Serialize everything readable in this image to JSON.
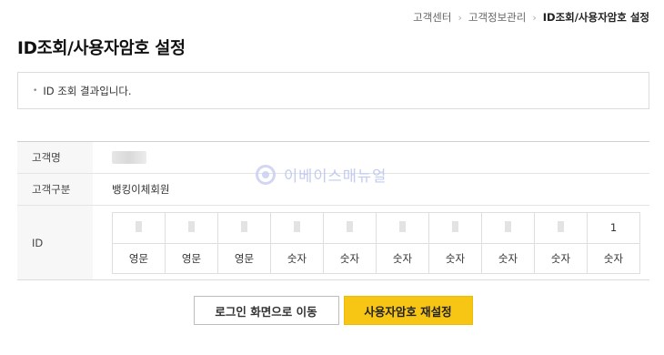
{
  "breadcrumb": {
    "items": [
      "고객센터",
      "고객정보관리",
      "ID조회/사용자암호 설정"
    ]
  },
  "page_title": "ID조회/사용자암호 설정",
  "result_message": "ID 조회 결과입니다.",
  "table": {
    "name_label": "고객명",
    "type_label": "고객구분",
    "type_value": "뱅킹이체회원",
    "id_label": "ID"
  },
  "id_chars": [
    "",
    "",
    "",
    "",
    "",
    "",
    "",
    "",
    "",
    "1"
  ],
  "id_kinds": [
    "영문",
    "영문",
    "영문",
    "숫자",
    "숫자",
    "숫자",
    "숫자",
    "숫자",
    "숫자",
    "숫자"
  ],
  "watermark": "이베이스매뉴얼",
  "buttons": {
    "login": "로그인 화면으로 이동",
    "reset": "사용자암호 재설정"
  },
  "colors": {
    "accent_button": "#f7c614",
    "watermark": "#b8c3ee"
  }
}
